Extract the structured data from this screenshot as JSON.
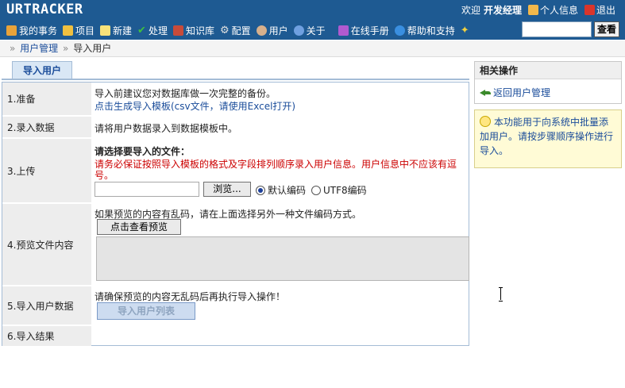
{
  "app": {
    "logo": "URTRACKER"
  },
  "userbar": {
    "welcome": "欢迎",
    "username": "开发经理",
    "profile": "个人信息",
    "logout": "退出"
  },
  "menu": [
    {
      "label": "我的事务",
      "icon": "home-icon",
      "color": "#e8a33a"
    },
    {
      "label": "项目",
      "icon": "database-icon",
      "color": "#f0c040"
    },
    {
      "label": "新建",
      "icon": "new-icon",
      "color": "#f7e27a"
    },
    {
      "label": "处理",
      "icon": "check-icon",
      "color": "#3fbf3f"
    },
    {
      "label": "知识库",
      "icon": "books-icon",
      "color": "#c84b3a"
    },
    {
      "label": "配置",
      "icon": "gear-icon",
      "color": "#d8d8d8"
    },
    {
      "label": "用户",
      "icon": "users-icon",
      "color": "#d7b08c"
    },
    {
      "label": "关于",
      "icon": "info-icon",
      "color": "#6fa0e0"
    },
    {
      "label": "在线手册",
      "icon": "manual-icon",
      "color": "#b05ad0"
    },
    {
      "label": "帮助和支持",
      "icon": "help-icon",
      "color": "#3a8fe0"
    },
    {
      "label": "",
      "icon": "sparkle-icon",
      "color": "#f0d040"
    }
  ],
  "search": {
    "value": "",
    "button": "查看"
  },
  "breadcrumb": {
    "sep": "»",
    "parent": "用户管理",
    "current": "导入用户"
  },
  "tab": {
    "label": "导入用户"
  },
  "steps": {
    "prepare": {
      "label": "1.准备",
      "line1": "导入前建议您对数据库做一次完整的备份。",
      "link": "点击生成导入模板(csv文件，请使用Excel打开)"
    },
    "enter": {
      "label": "2.录入数据",
      "text": "请将用户数据录入到数据模板中。"
    },
    "upload": {
      "label": "3.上传",
      "heading": "请选择要导入的文件：",
      "warning1": "请务必保证按照导入模板的格式及字段排列顺序录入用户信息。用户信息中不应该有逗",
      "warning2": "号。",
      "browse": "浏览...",
      "encoding_default": "默认编码",
      "encoding_utf8": "UTF8编码"
    },
    "preview": {
      "label": "4.预览文件内容",
      "hint": "如果预览的内容有乱码，请在上面选择另外一种文件编码方式。",
      "button": "点击查看预览"
    },
    "import": {
      "label": "5.导入用户数据",
      "text": "请确保预览的内容无乱码后再执行导入操作！",
      "button": "导入用户列表"
    },
    "result": {
      "label": "6.导入结果"
    }
  },
  "sidebar": {
    "title": "相关操作",
    "back_link": "返回用户管理",
    "info": "本功能用于向系统中批量添加用户。请按步骤顺序操作进行导入。"
  },
  "colors": {
    "header": "#1e5a92",
    "link": "#1a4c9a",
    "warning": "#cc0000",
    "info_bg": "#fffbd6"
  }
}
